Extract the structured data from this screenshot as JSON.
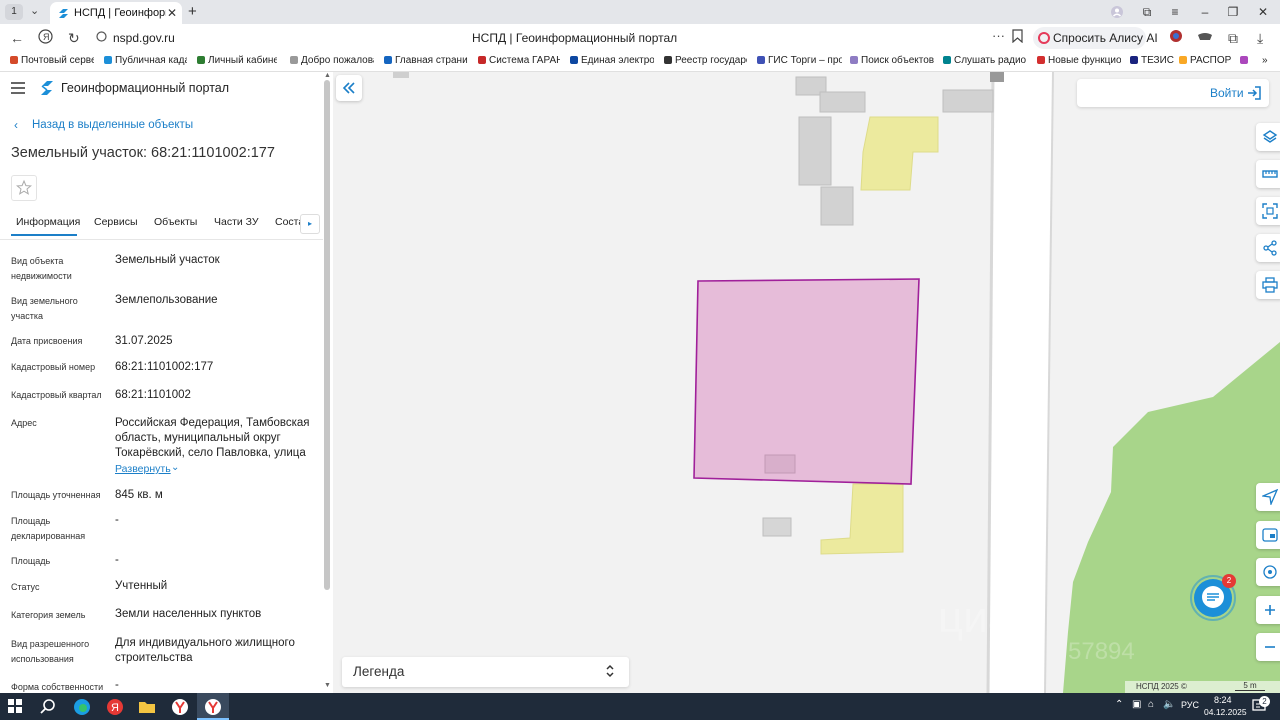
{
  "browser": {
    "tab_count": "1",
    "tab_title": "НСПД | Геоинформаци",
    "url": "nspd.gov.ru",
    "page_title": "НСПД | Геоинформационный портал",
    "alice_label": "Спросить Алису AI"
  },
  "bookmarks": [
    "Почтовый сервер",
    "Публичная кадас",
    "Личный кабинет",
    "Добро пожалова",
    "Главная страниц",
    "Система ГАРАНТ",
    "Единая электрон",
    "Реестр государст",
    "ГИС Торги – прод",
    "Поиск объектов н",
    "Слушать радио о",
    "Новые функцион",
    "ТЕЗИС",
    "РАСПОР"
  ],
  "portal": {
    "app_title": "Геоинформационный портал",
    "back_link": "Назад в выделенные объекты",
    "object_title": "Земельный участок: 68:21:1101002:177",
    "tabs": [
      "Информация",
      "Сервисы",
      "Объекты",
      "Части ЗУ",
      "Соста"
    ],
    "fields": [
      {
        "label": "Вид объекта недвижимости",
        "value": "Земельный участок"
      },
      {
        "label": "Вид земельного участка",
        "value": "Землепользование"
      },
      {
        "label": "Дата присвоения",
        "value": "31.07.2025"
      },
      {
        "label": "Кадастровый номер",
        "value": "68:21:1101002:177"
      },
      {
        "label": "Кадастровый квартал",
        "value": "68:21:1101002"
      },
      {
        "label": "Адрес",
        "value": "Российская Федерация, Тамбовская область, муниципальный округ Токарёвский, село Павловка, улица"
      },
      {
        "label": "Площадь уточненная",
        "value": "845 кв. м"
      },
      {
        "label": "Площадь декларированная",
        "value": "-"
      },
      {
        "label": "Площадь",
        "value": "-"
      },
      {
        "label": "Статус",
        "value": "Учтенный"
      },
      {
        "label": "Категория земель",
        "value": "Земли населенных пунктов"
      },
      {
        "label": "Вид разрешенного использования",
        "value": "Для индивидуального жилищного строительства"
      },
      {
        "label": "Форма собственности",
        "value": "-"
      }
    ],
    "expand_link": "Развернуть"
  },
  "map": {
    "login_label": "Войти",
    "legend_label": "Легенда",
    "chat_badge": "2",
    "copyright": "НСПД 2025 ©",
    "scale": "5 m",
    "watermark_word": "циан",
    "watermark_number": "57894",
    "parcel_color": "#e6bcd9",
    "parcel_border": "#a0209a"
  },
  "taskbar": {
    "language": "РУС",
    "time": "8:24",
    "date": "04.12.2025"
  }
}
